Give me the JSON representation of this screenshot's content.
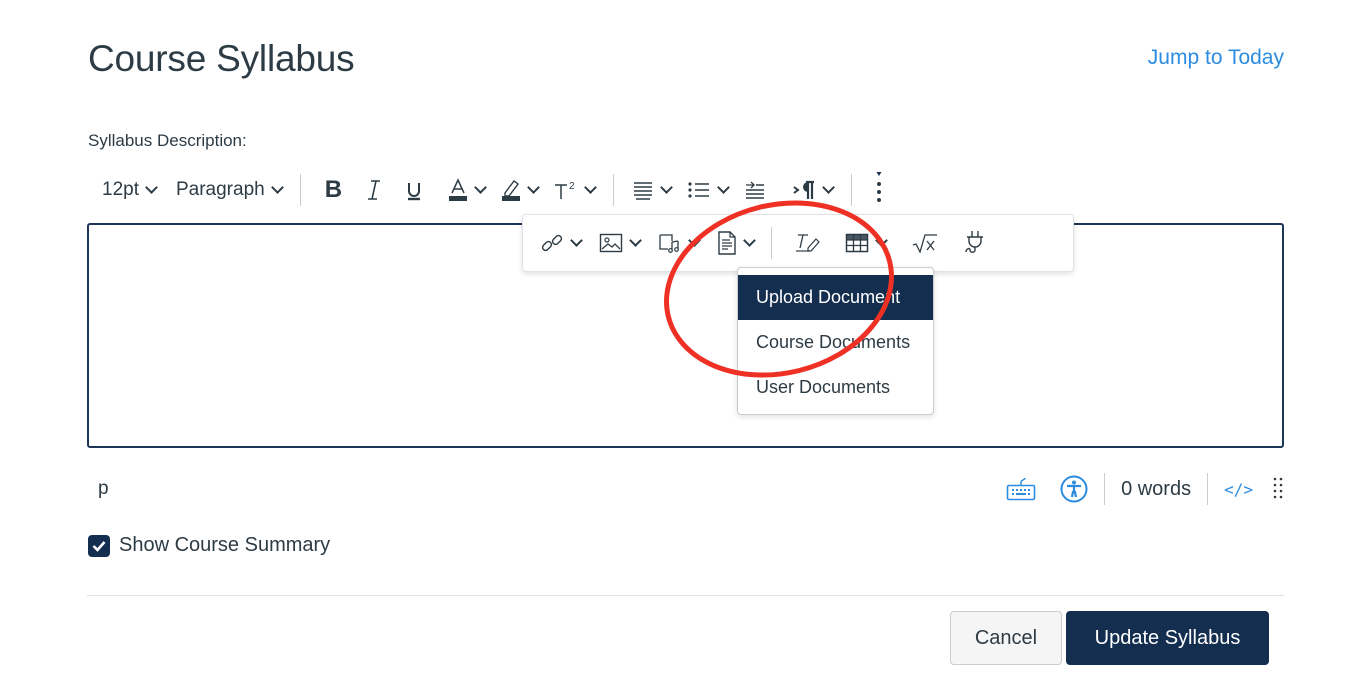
{
  "page": {
    "title": "Course Syllabus",
    "jump_link": "Jump to Today",
    "field_label": "Syllabus Description:"
  },
  "toolbar": {
    "font_size": "12pt",
    "block_format": "Paragraph",
    "buttons": [
      {
        "name": "bold",
        "icon": "bold-icon"
      },
      {
        "name": "italic",
        "icon": "italic-icon"
      },
      {
        "name": "underline",
        "icon": "underline-icon"
      },
      {
        "name": "text-color",
        "icon": "text-color-icon"
      },
      {
        "name": "highlight",
        "icon": "highlight-icon"
      },
      {
        "name": "superscript",
        "icon": "superscript-icon"
      },
      {
        "name": "align",
        "icon": "align-icon"
      },
      {
        "name": "list",
        "icon": "list-icon"
      },
      {
        "name": "indent",
        "icon": "indent-icon"
      },
      {
        "name": "direction",
        "icon": "paragraph-direction-icon"
      },
      {
        "name": "more",
        "icon": "more-vertical-icon"
      }
    ]
  },
  "overflow_toolbar": {
    "buttons": [
      {
        "name": "link",
        "icon": "link-icon"
      },
      {
        "name": "image",
        "icon": "image-icon"
      },
      {
        "name": "media",
        "icon": "media-icon"
      },
      {
        "name": "document",
        "icon": "document-icon"
      },
      {
        "name": "clear-formatting",
        "icon": "clear-formatting-icon"
      },
      {
        "name": "table",
        "icon": "table-icon"
      },
      {
        "name": "equation",
        "icon": "equation-icon"
      },
      {
        "name": "apps",
        "icon": "plug-icon"
      }
    ]
  },
  "document_menu": {
    "items": [
      {
        "label": "Upload Document",
        "active": true
      },
      {
        "label": "Course Documents",
        "active": false
      },
      {
        "label": "User Documents",
        "active": false
      }
    ]
  },
  "statusbar": {
    "path": "p",
    "word_count": "0 words",
    "html_toggle": "</>"
  },
  "options": {
    "show_summary_label": "Show Course Summary",
    "show_summary_checked": true
  },
  "actions": {
    "cancel": "Cancel",
    "update": "Update Syllabus"
  },
  "colors": {
    "primary": "#142e4f",
    "link": "#2b8ce0",
    "annotation": "#ee3124"
  }
}
